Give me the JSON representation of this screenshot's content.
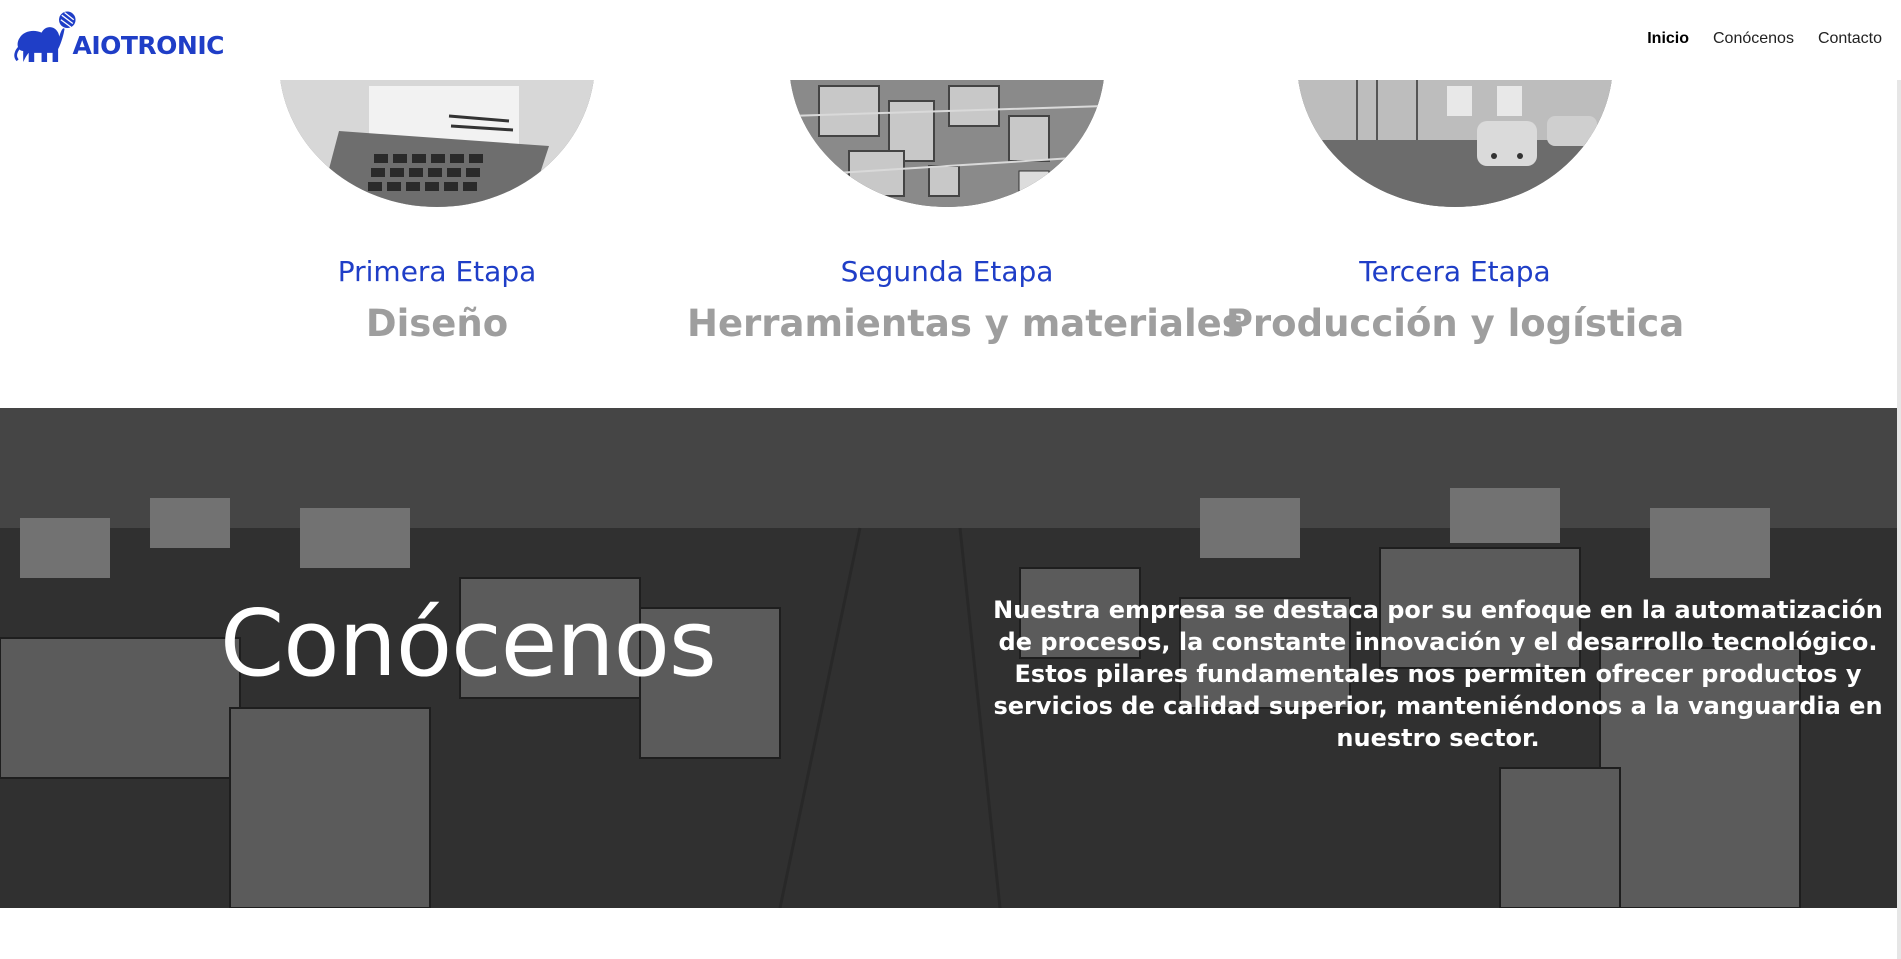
{
  "brand": {
    "name": "AIOTRONIC",
    "color": "#1f3ec7",
    "logo_icon": "elephant-with-ball-icon"
  },
  "nav": {
    "items": [
      {
        "label": "Inicio",
        "active": true
      },
      {
        "label": "Conócenos",
        "active": false
      },
      {
        "label": "Contacto",
        "active": false
      }
    ]
  },
  "stages": [
    {
      "step": "Primera Etapa",
      "title": "Diseño",
      "image": "laptop-photo"
    },
    {
      "step": "Segunda Etapa",
      "title": "Herramientas y materiales",
      "image": "factory-floor-photo"
    },
    {
      "step": "Tercera Etapa",
      "title": "Producción y logística",
      "image": "warehouse-robots-photo"
    }
  ],
  "hero": {
    "title": "Conócenos",
    "text": "Nuestra empresa se destaca por su enfoque en la automatización de procesos, la constante innovación y el desarrollo tecnológico. Estos pilares fundamentales nos permiten ofrecer productos y servicios de calidad superior, manteniéndonos a la vanguardia en nuestro sector.",
    "background": "factory-machines-photo"
  },
  "colors": {
    "accent": "#1f3ec7",
    "stage_title": "#9e9e9e",
    "hero_text": "#ffffff"
  }
}
